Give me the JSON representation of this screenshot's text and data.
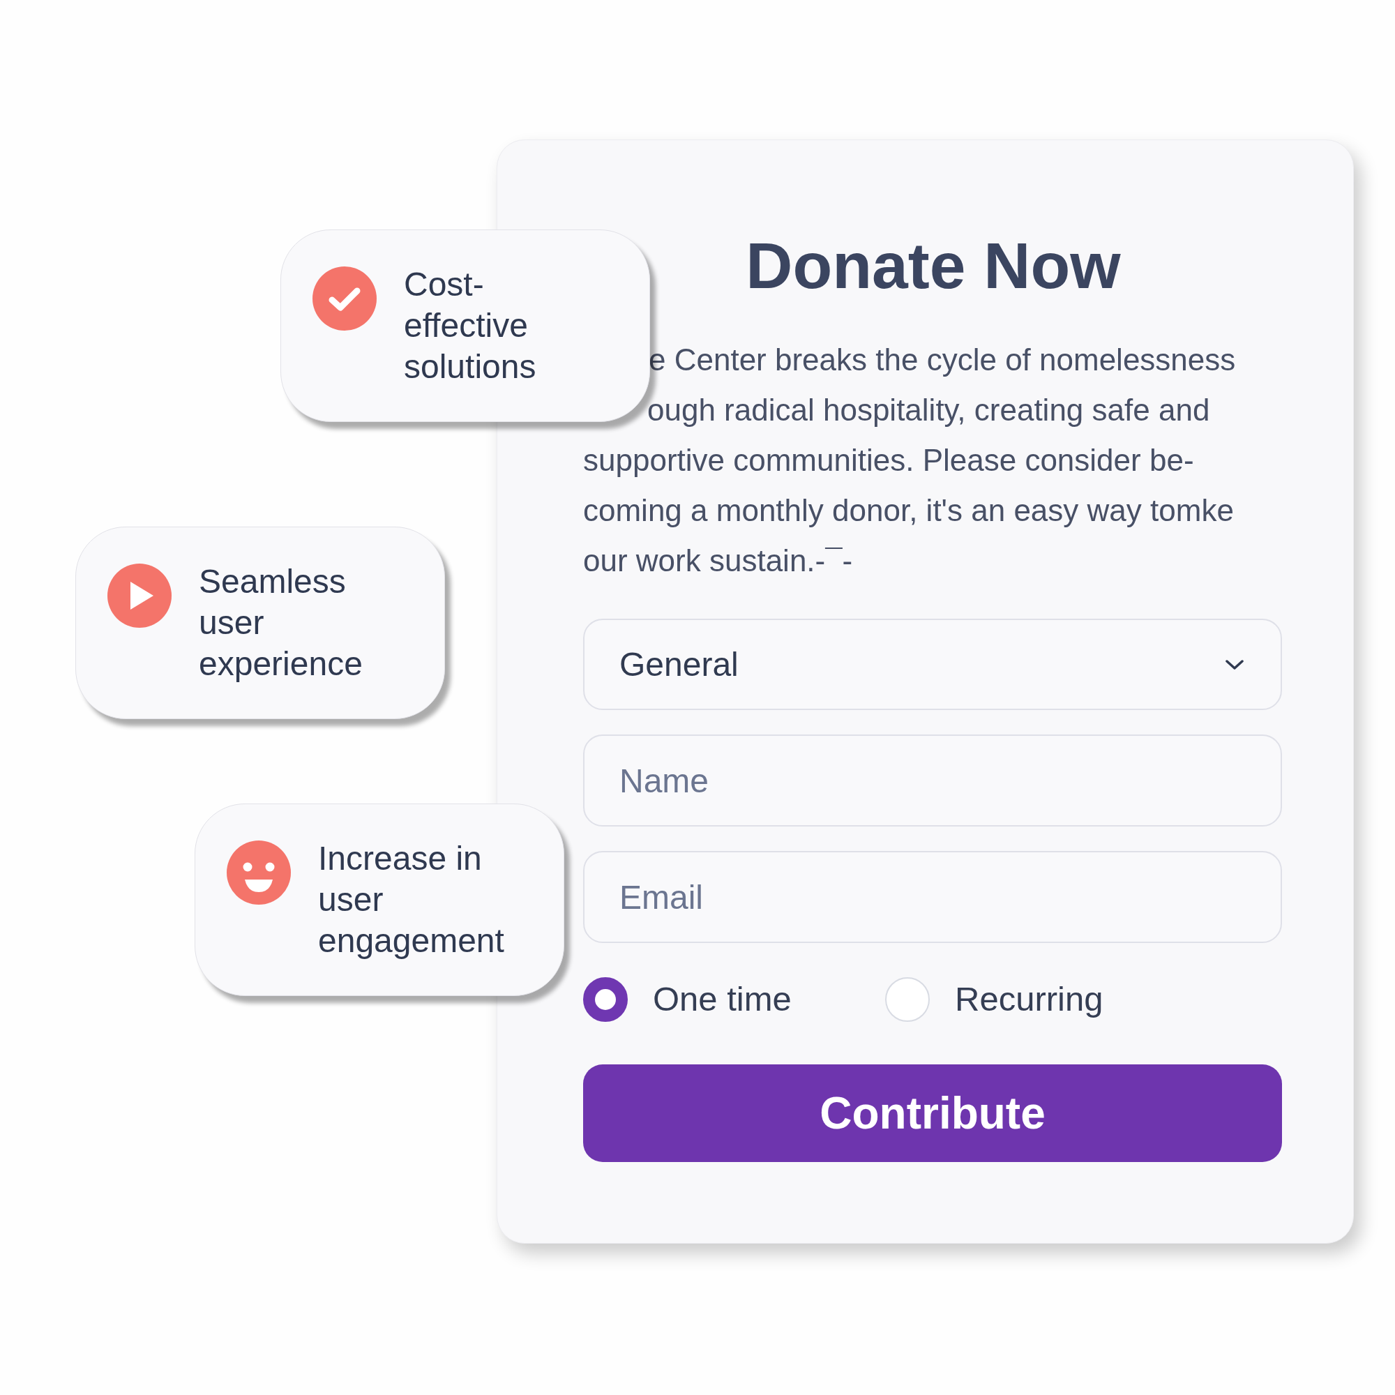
{
  "badges": [
    {
      "label": "Cost-effective solutions"
    },
    {
      "label": "Seamless user experience"
    },
    {
      "label": "Increase in user engagement"
    }
  ],
  "form": {
    "title": "Donate Now",
    "description_lines": [
      "e Center breaks the cycle of nomelessness",
      "ough radical hospitality, creating safe and",
      "supportive communities. Please consider be-",
      "coming a monthly donor, it's an easy way tomke",
      "our work sustain.-¯-"
    ],
    "category_select": {
      "value": "General"
    },
    "fields": [
      {
        "placeholder": "Name"
      },
      {
        "placeholder": "Email"
      }
    ],
    "frequency_options": [
      {
        "label": "One time",
        "selected": true
      },
      {
        "label": "Recurring",
        "selected": false
      }
    ],
    "submit_button": "Contribute"
  }
}
